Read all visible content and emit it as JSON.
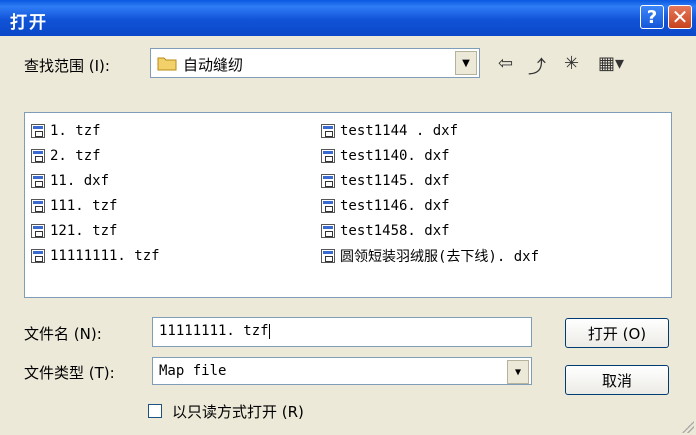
{
  "window": {
    "title": "打开",
    "help_glyph": "?",
    "close_glyph": "✕"
  },
  "lookin": {
    "label": "查找范围 (I):",
    "value": "自动缝纫"
  },
  "toolbar": {
    "back_glyph": "⇦",
    "up_glyph": "⤴",
    "new_folder_glyph": "✳",
    "views_glyph": "▦▾"
  },
  "files": {
    "col1": [
      "1. tzf",
      "2. tzf",
      "11. dxf",
      "111. tzf",
      "121. tzf",
      "11111111. tzf"
    ],
    "col2": [
      "test1144 . dxf",
      "test1140. dxf",
      "test1145. dxf",
      "test1146. dxf",
      "test1458. dxf",
      "圆领短装羽绒服(去下线). dxf"
    ]
  },
  "filename": {
    "label": "文件名 (N):",
    "value": "11111111. tzf"
  },
  "filetype": {
    "label": "文件类型 (T):",
    "value": "Map file"
  },
  "readonly": {
    "label": "以只读方式打开 (R)"
  },
  "buttons": {
    "open": "打开 (O)",
    "cancel": "取消"
  }
}
